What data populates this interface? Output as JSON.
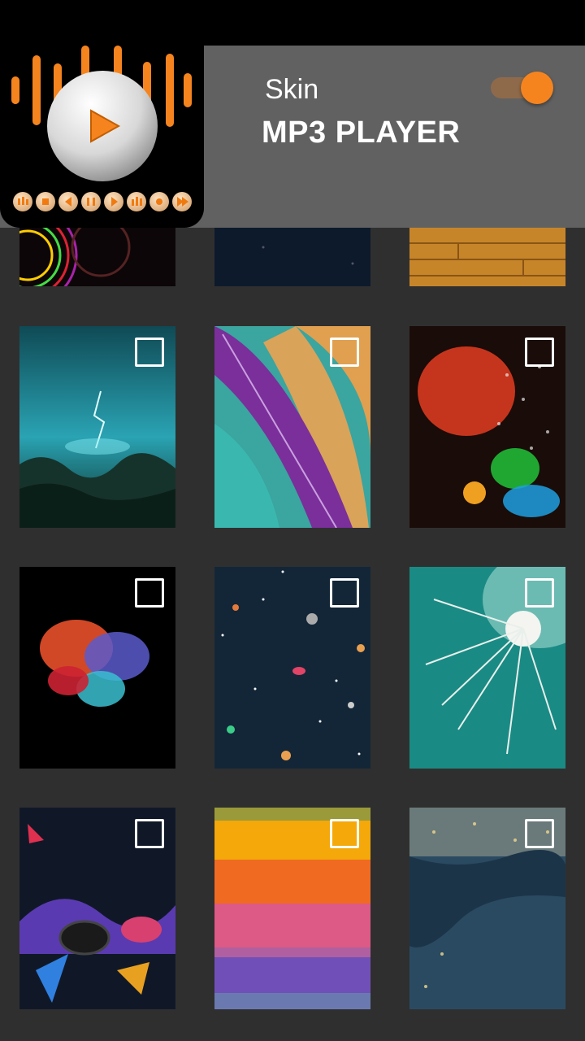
{
  "header": {
    "small_title": "Skin",
    "big_title": "MP3 PLAYER",
    "toggle_on": true,
    "accent_color": "#f5841f",
    "header_bg": "#616161"
  },
  "logo": {
    "icon": "music-player-logo-icon"
  },
  "skins": [
    {
      "name": "neon-circles-skin",
      "icon": "neon-circles-thumbnail"
    },
    {
      "name": "night-sky-skin",
      "icon": "night-sky-thumbnail"
    },
    {
      "name": "wood-planks-skin",
      "icon": "wood-planks-thumbnail"
    },
    {
      "name": "storm-skin",
      "icon": "lightning-storm-thumbnail",
      "selected": false
    },
    {
      "name": "feathers-skin",
      "icon": "feathers-thumbnail",
      "selected": false
    },
    {
      "name": "raindrops-skin",
      "icon": "raindrops-thumbnail",
      "selected": false
    },
    {
      "name": "color-burst-skin",
      "icon": "color-burst-thumbnail",
      "selected": false
    },
    {
      "name": "space-planets-skin",
      "icon": "space-planets-thumbnail",
      "selected": false
    },
    {
      "name": "dandelion-skin",
      "icon": "dandelion-thumbnail",
      "selected": false
    },
    {
      "name": "abstract-shapes-skin",
      "icon": "abstract-shapes-thumbnail",
      "selected": false
    },
    {
      "name": "rainbow-wood-skin",
      "icon": "rainbow-wood-thumbnail",
      "selected": false
    },
    {
      "name": "ocean-wave-skin",
      "icon": "ocean-wave-thumbnail",
      "selected": false
    }
  ]
}
